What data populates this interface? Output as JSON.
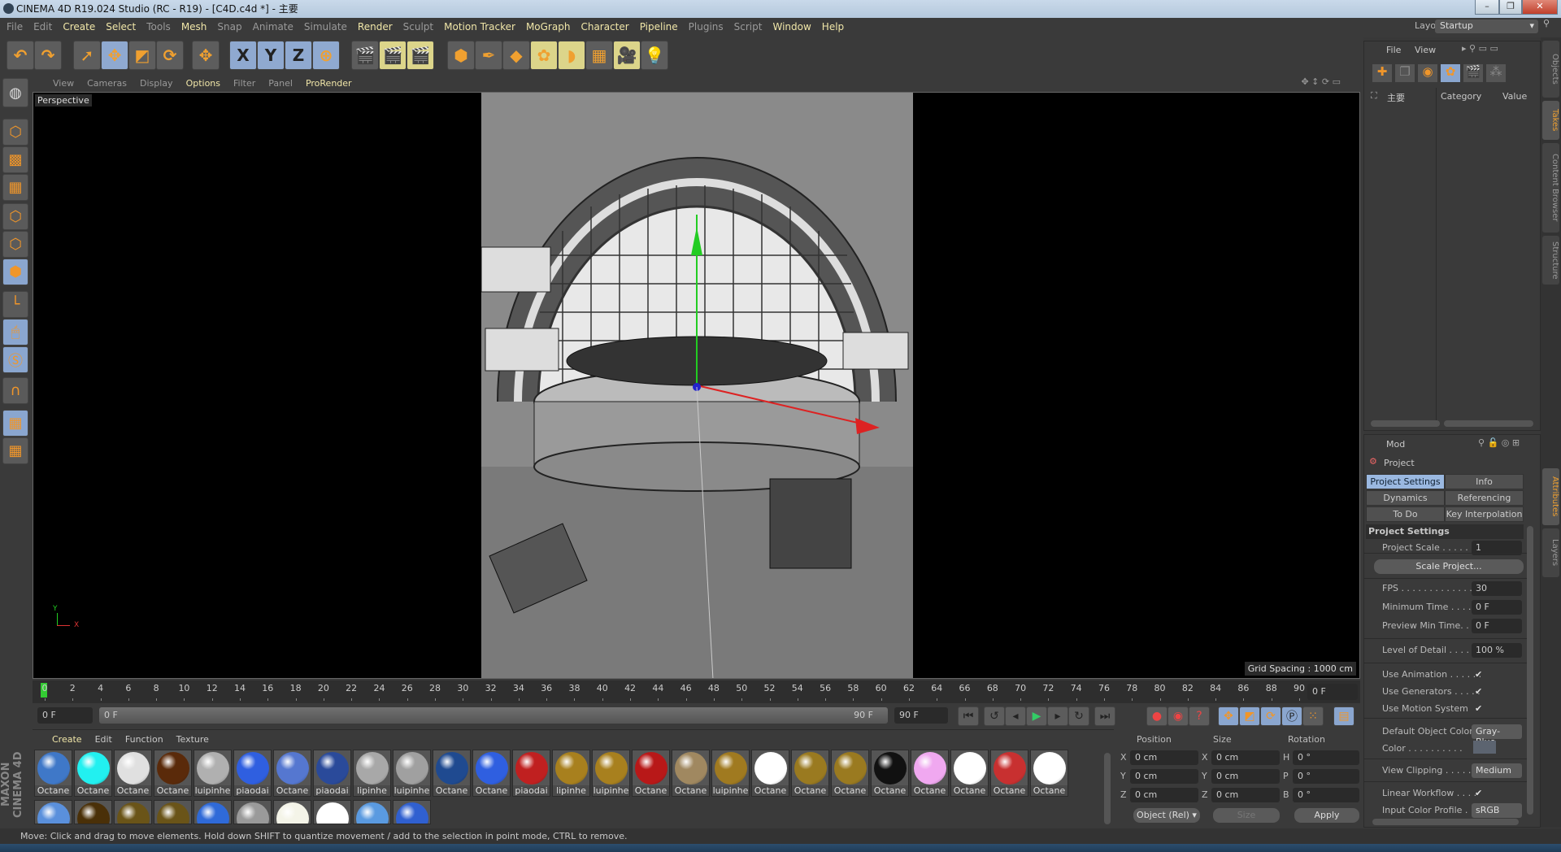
{
  "window": {
    "title": "CINEMA 4D R19.024 Studio (RC - R19) - [C4D.c4d *] - 主要",
    "minimize": "–",
    "maximize": "❐",
    "close": "✕"
  },
  "menu": [
    {
      "label": "File",
      "hl": false
    },
    {
      "label": "Edit",
      "hl": false
    },
    {
      "label": "Create",
      "hl": true
    },
    {
      "label": "Select",
      "hl": true
    },
    {
      "label": "Tools",
      "hl": false
    },
    {
      "label": "Mesh",
      "hl": true
    },
    {
      "label": "Snap",
      "hl": false
    },
    {
      "label": "Animate",
      "hl": false
    },
    {
      "label": "Simulate",
      "hl": false
    },
    {
      "label": "Render",
      "hl": true
    },
    {
      "label": "Sculpt",
      "hl": false
    },
    {
      "label": "Motion Tracker",
      "hl": true
    },
    {
      "label": "MoGraph",
      "hl": true
    },
    {
      "label": "Character",
      "hl": true
    },
    {
      "label": "Pipeline",
      "hl": true
    },
    {
      "label": "Plugins",
      "hl": false
    },
    {
      "label": "Script",
      "hl": false
    },
    {
      "label": "Window",
      "hl": true
    },
    {
      "label": "Help",
      "hl": true
    }
  ],
  "toolbar": [
    {
      "name": "undo",
      "glyph": "↶",
      "style": ""
    },
    {
      "name": "redo",
      "glyph": "↷",
      "style": ""
    },
    {
      "name": "live-selection",
      "glyph": "➚",
      "style": ""
    },
    {
      "name": "move",
      "glyph": "✥",
      "style": "on"
    },
    {
      "name": "scale",
      "glyph": "◩",
      "style": ""
    },
    {
      "name": "rotate",
      "glyph": "⟳",
      "style": ""
    },
    {
      "name": "recent-tool",
      "glyph": "✥",
      "style": ""
    },
    {
      "name": "x-axis",
      "glyph": "X",
      "style": "on"
    },
    {
      "name": "y-axis",
      "glyph": "Y",
      "style": "on"
    },
    {
      "name": "z-axis",
      "glyph": "Z",
      "style": "on"
    },
    {
      "name": "coordinate-system",
      "glyph": "⊕",
      "style": "on"
    },
    {
      "name": "render-view",
      "glyph": "🎬",
      "style": ""
    },
    {
      "name": "render-picture-viewer",
      "glyph": "🎬",
      "style": "yl"
    },
    {
      "name": "render-settings",
      "glyph": "🎬",
      "style": "yl"
    },
    {
      "name": "cube",
      "glyph": "⬢",
      "style": ""
    },
    {
      "name": "pen",
      "glyph": "✒",
      "style": ""
    },
    {
      "name": "subdivision-surface",
      "glyph": "◆",
      "style": ""
    },
    {
      "name": "cloner",
      "glyph": "✿",
      "style": "yl"
    },
    {
      "name": "deformer",
      "glyph": "◗",
      "style": "yl"
    },
    {
      "name": "floor",
      "glyph": "▦",
      "style": ""
    },
    {
      "name": "camera",
      "glyph": "🎥",
      "style": "yl"
    },
    {
      "name": "light",
      "glyph": "💡",
      "style": ""
    }
  ],
  "left_tools": [
    {
      "name": "make-editable",
      "glyph": "⬡",
      "on": false
    },
    {
      "name": "texture-mode",
      "glyph": "▩",
      "on": false
    },
    {
      "name": "workplane",
      "glyph": "▦",
      "on": false
    },
    {
      "name": "points-mode",
      "glyph": "⬡",
      "on": false
    },
    {
      "name": "edges-mode",
      "glyph": "⬡",
      "on": false
    },
    {
      "name": "polygons-mode",
      "glyph": "⬢",
      "on": true
    },
    {
      "name": "axis-mode",
      "glyph": "└",
      "on": false
    },
    {
      "name": "tweak-mode",
      "glyph": "🖱",
      "on": true
    },
    {
      "name": "solo",
      "glyph": "Ⓢ",
      "on": true
    },
    {
      "name": "snap",
      "glyph": "∩",
      "on": false
    },
    {
      "name": "lock-workplane",
      "glyph": "▦",
      "on": true
    },
    {
      "name": "planar-workplane",
      "glyph": "▦",
      "on": false
    }
  ],
  "viewport": {
    "menu": [
      "View",
      "Cameras",
      "Display",
      "Options",
      "Filter",
      "Panel",
      "ProRender"
    ],
    "highlighted": [
      "Options",
      "ProRender"
    ],
    "camera": "Perspective",
    "grid_spacing": "Grid Spacing : 1000 cm",
    "axis_y": "Y",
    "axis_x": "X"
  },
  "timeline": {
    "ticks": [
      0,
      2,
      4,
      6,
      8,
      10,
      12,
      14,
      16,
      18,
      20,
      22,
      24,
      26,
      28,
      30,
      32,
      34,
      36,
      38,
      40,
      42,
      44,
      46,
      48,
      50,
      52,
      54,
      56,
      58,
      60,
      62,
      64,
      66,
      68,
      70,
      72,
      74,
      76,
      78,
      80,
      82,
      84,
      86,
      88,
      90
    ],
    "current_frame": "0 F",
    "start_field": "0 F",
    "slider_start": "0 F",
    "slider_end": "90 F",
    "end_field": "90 F"
  },
  "materials": {
    "menu": [
      "Create",
      "Edit",
      "Function",
      "Texture"
    ],
    "row1": [
      {
        "name": "Octane",
        "color": "#3f78c8"
      },
      {
        "name": "Octane",
        "color": "#22f0f0"
      },
      {
        "name": "Octane",
        "color": "#e0e0e0"
      },
      {
        "name": "Octane",
        "color": "#5a2a0a"
      },
      {
        "name": "luipinhe",
        "color": "#b0b0b0"
      },
      {
        "name": "piaodai",
        "color": "#2f5fe0"
      },
      {
        "name": "Octane",
        "color": "#5577d0"
      },
      {
        "name": "piaodai",
        "color": "#2a4a9a"
      },
      {
        "name": "lipinhe",
        "color": "#a8a8a8"
      },
      {
        "name": "luipinhe",
        "color": "#a0a0a0"
      },
      {
        "name": "Octane",
        "color": "#1f4a90"
      },
      {
        "name": "Octane",
        "color": "#2f5fe0"
      },
      {
        "name": "piaodai",
        "color": "#c02020"
      },
      {
        "name": "lipinhe",
        "color": "#a8801e"
      },
      {
        "name": "luipinhe",
        "color": "#a8801e"
      },
      {
        "name": "Octane",
        "color": "#b81818"
      },
      {
        "name": "Octane",
        "color": "#a08860"
      },
      {
        "name": "luipinhe",
        "color": "#a07a20"
      },
      {
        "name": "Octane",
        "color": "#ffffff"
      },
      {
        "name": "Octane",
        "color": "#9a7a20"
      },
      {
        "name": "Octane",
        "color": "#9a7a20"
      },
      {
        "name": "Octane",
        "color": "#111111"
      },
      {
        "name": "Octane",
        "color": "#f0a8f0"
      },
      {
        "name": "Octane",
        "color": "#ffffff"
      },
      {
        "name": "Octane",
        "color": "#c83030"
      },
      {
        "name": "Octane",
        "color": "#ffffff"
      }
    ],
    "row2": [
      "#5a90dc",
      "#4a3008",
      "#6a5418",
      "#6a5418",
      "#2f6ad8",
      "#9a9a9a",
      "#f4f4e8",
      "#ffffff",
      "#5a9ae0",
      "#3060d0"
    ]
  },
  "coords": {
    "headers": [
      "Position",
      "Size",
      "Rotation"
    ],
    "rows": [
      {
        "pl": "X",
        "pv": "0 cm",
        "sl": "X",
        "sv": "0 cm",
        "rl": "H",
        "rv": "0 °"
      },
      {
        "pl": "Y",
        "pv": "0 cm",
        "sl": "Y",
        "sv": "0 cm",
        "rl": "P",
        "rv": "0 °"
      },
      {
        "pl": "Z",
        "pv": "0 cm",
        "sl": "Z",
        "sv": "0 cm",
        "rl": "B",
        "rv": "0 °"
      }
    ],
    "mode": "Object (Rel) ▾",
    "size_mode": "Size",
    "apply": "Apply"
  },
  "status": "Move: Click and drag to move elements. Hold down SHIFT to quantize movement / add to the selection in point mode, CTRL to remove.",
  "layout": {
    "label": "Layout:",
    "value": "Startup"
  },
  "objects": {
    "menu": [
      "File",
      "View"
    ],
    "root": "主要",
    "cols": [
      "Category",
      "Value"
    ]
  },
  "attributes": {
    "mode": "Mod",
    "object": "Project",
    "tabs": [
      "Project Settings",
      "Info",
      "Dynamics",
      "Referencing",
      "To Do",
      "Key Interpolation"
    ],
    "section": "Project Settings",
    "project_scale_label": "Project Scale . . . . . . .",
    "project_scale": "1",
    "scale_project": "Scale Project...",
    "fps_label": "FPS . . . . . . . . . . . . . .",
    "fps": "30",
    "min_time_label": "Minimum Time . . . . .",
    "min_time": "0 F",
    "preview_min_label": "Preview Min Time. . .",
    "preview_min": "0 F",
    "lod_label": "Level of Detail . . . . . .",
    "lod": "100 %",
    "use_animation": "Use Animation . . . . . .",
    "use_generators": "Use Generators . . . . .",
    "use_motion": "Use Motion System",
    "check": "✔",
    "default_color_label": "Default Object Color",
    "default_color": "Gray-Blue",
    "color_label": "Color . . . . . . . . . .",
    "color_swatch": "#5c6470",
    "view_clipping_label": "View Clipping . . . . . .",
    "view_clipping": "Medium",
    "linear_workflow": "Linear Workflow . . . .",
    "input_profile_label": "Input Color Profile . .",
    "input_profile": "sRGB"
  },
  "side_tabs": [
    "Objects",
    "Takes",
    "Content Browser",
    "Structure",
    "Attributes",
    "Layers"
  ],
  "brand": "MAXON CINEMA 4D"
}
